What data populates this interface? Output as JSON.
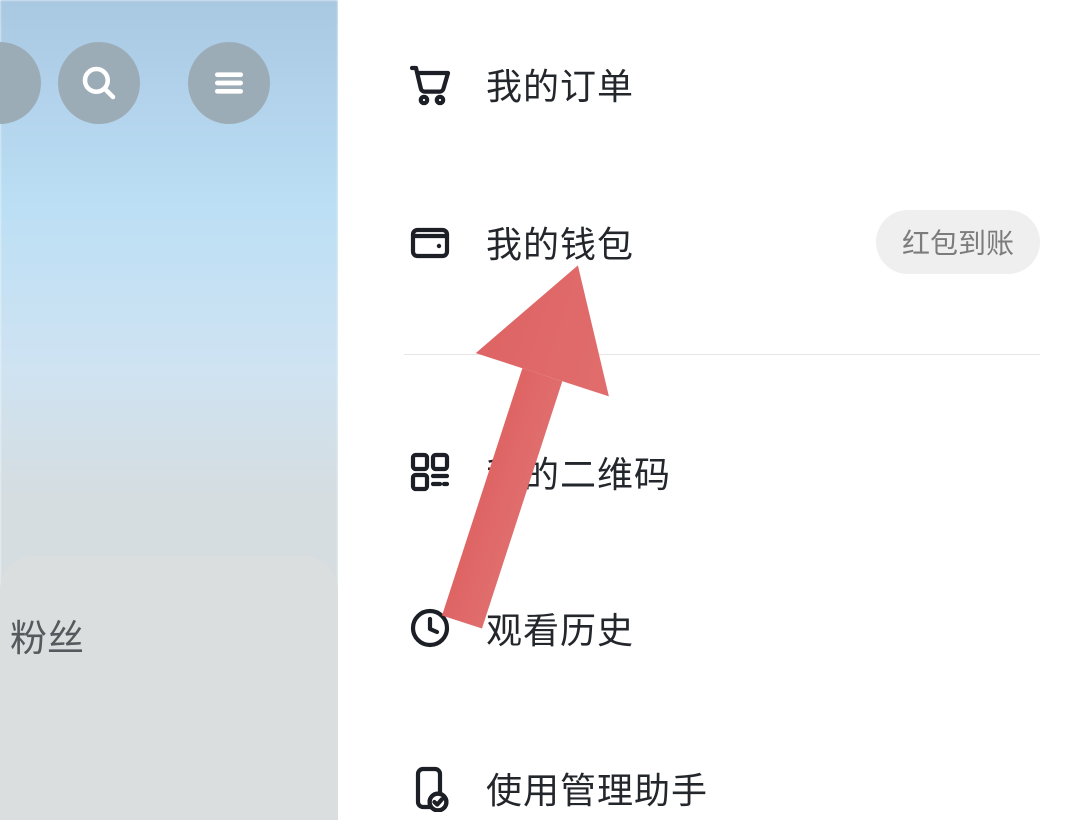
{
  "background": {
    "fans_label": "粉丝",
    "icons": {
      "search": "search-icon",
      "menu": "menu-icon"
    }
  },
  "drawer": {
    "items": {
      "orders": {
        "label": "我的订单"
      },
      "wallet": {
        "label": "我的钱包",
        "badge": "红包到账"
      },
      "qr": {
        "label": "我的二维码"
      },
      "history": {
        "label": "观看历史"
      },
      "helper": {
        "label": "使用管理助手"
      }
    }
  },
  "annotation": {
    "arrow_color": "#e06767"
  }
}
